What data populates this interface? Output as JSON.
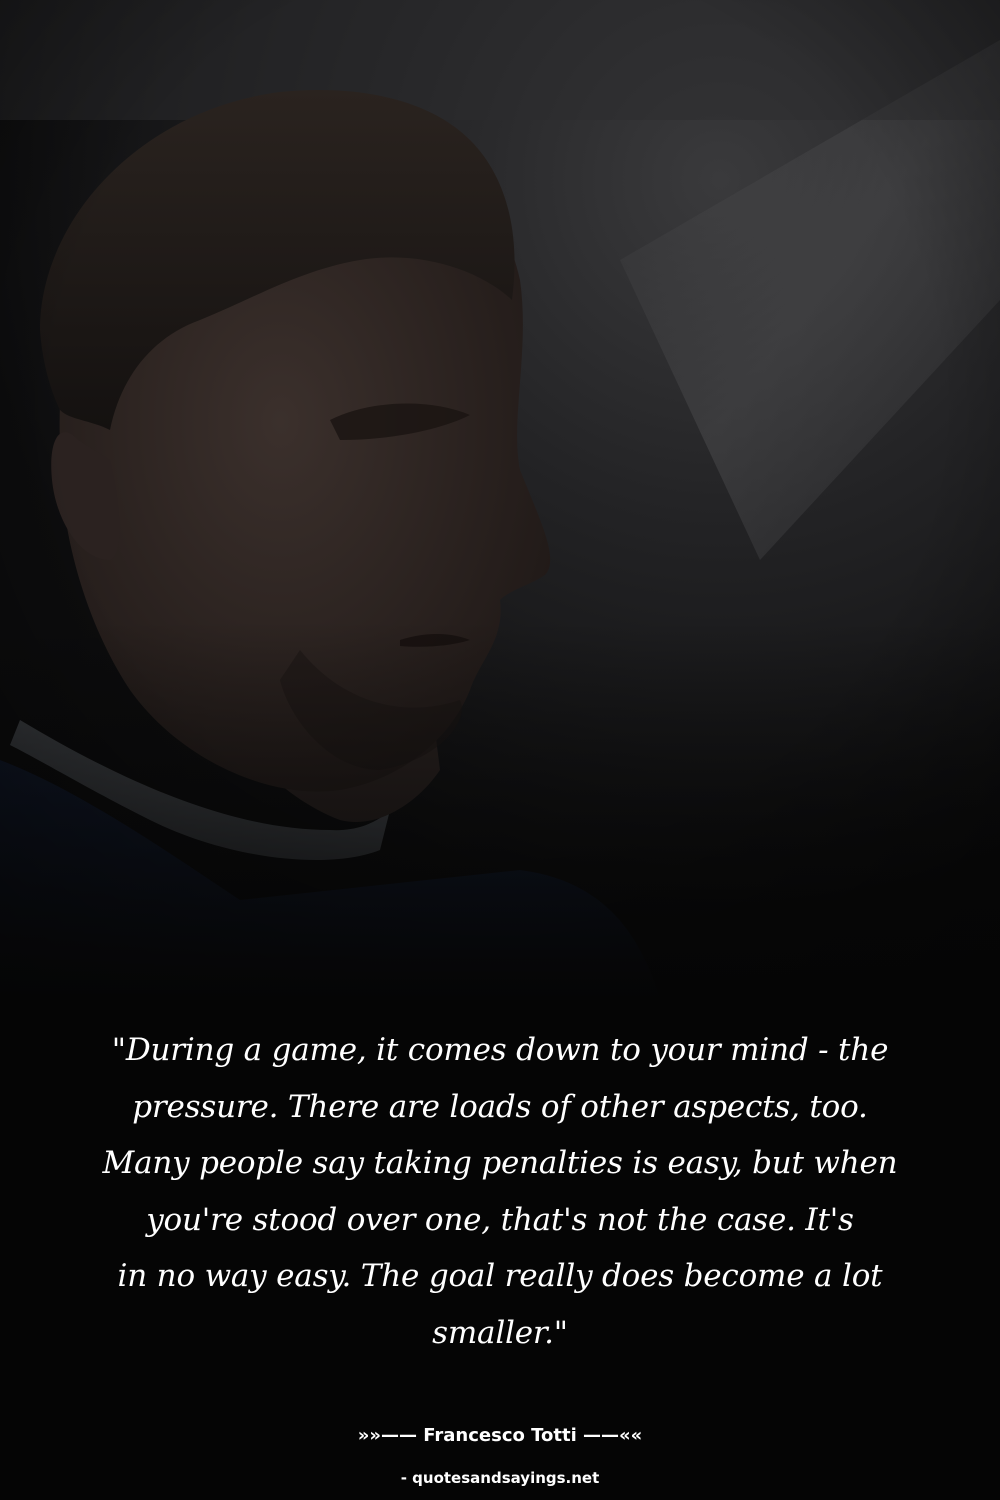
{
  "photo": {
    "subject": "man-portrait-dark-background"
  },
  "quote": {
    "lines": [
      "\"During a game, it comes down to your mind - the",
      "pressure. There are loads of other aspects, too.",
      "Many people say taking penalties is easy, but when",
      "you're stood over one, that's not the case. It's",
      "in no way easy. The goal really does become a lot",
      "smaller.\""
    ]
  },
  "attribution": {
    "author_line": "»»—— Francesco Totti ——««",
    "source_line": "- quotesandsayings.net"
  },
  "colors": {
    "background": "#050505",
    "text": "#ffffff"
  }
}
